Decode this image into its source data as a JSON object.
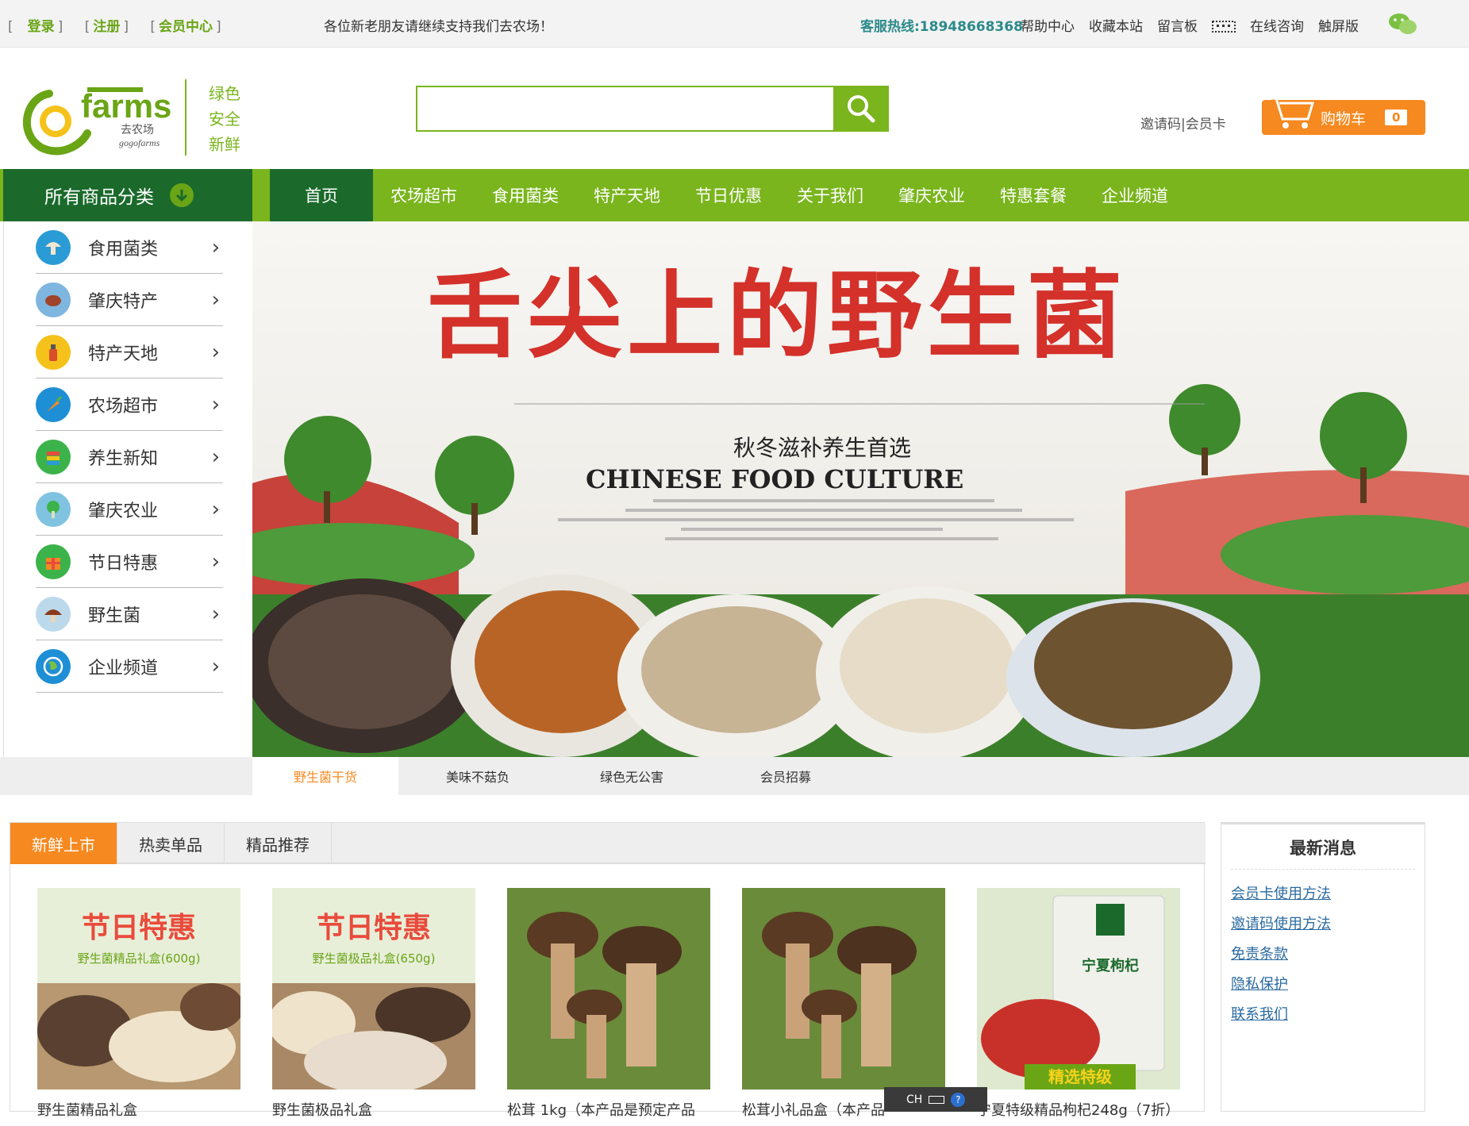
{
  "topbar": {
    "login": "登录",
    "register": "注册",
    "member_center": "会员中心",
    "bracket_l": "[",
    "bracket_r": "]",
    "notice": "各位新老朋友请继续支持我们去农场！",
    "hotline": "客服热线:18948668368",
    "links": [
      "帮助中心",
      "收藏本站",
      "留言板",
      "在线咨询",
      "触屏版"
    ]
  },
  "header": {
    "logo_text": "farms",
    "logo_cn": "去农场",
    "logo_en": "gogofarms",
    "slogan": [
      "绿色",
      "安全",
      "新鲜"
    ],
    "search_placeholder": "",
    "invite": "邀请码|会员卡",
    "cart_label": "购物车",
    "cart_count": "0"
  },
  "nav": {
    "all_categories": "所有商品分类",
    "items": [
      "首页",
      "农场超市",
      "食用菌类",
      "特产天地",
      "节日优惠",
      "关于我们",
      "肇庆农业",
      "特惠套餐",
      "企业频道"
    ]
  },
  "sidebar": {
    "items": [
      {
        "label": "食用菌类",
        "icon": "mushroom-icon"
      },
      {
        "label": "肇庆特产",
        "icon": "specialty-icon"
      },
      {
        "label": "特产天地",
        "icon": "bottle-icon"
      },
      {
        "label": "农场超市",
        "icon": "carrot-icon"
      },
      {
        "label": "养生新知",
        "icon": "books-icon"
      },
      {
        "label": "肇庆农业",
        "icon": "vegetable-icon"
      },
      {
        "label": "节日特惠",
        "icon": "gift-icon"
      },
      {
        "label": "野生菌",
        "icon": "wild-mushroom-icon"
      },
      {
        "label": "企业频道",
        "icon": "globe-icon"
      }
    ]
  },
  "banner": {
    "headline": "舌尖上的野生菌",
    "subtitle": "秋冬滋补养生首选",
    "title_en": "CHINESE FOOD CULTURE",
    "tabs": [
      "野生菌干货",
      "美味不菇负",
      "绿色无公害",
      "会员招募"
    ]
  },
  "products": {
    "tabs": [
      "新鲜上市",
      "热卖单品",
      "精品推荐"
    ],
    "items": [
      {
        "name": "野生菌精品礼盒",
        "tag": "节日特惠",
        "sub": "野生菌精品礼盒(600g)"
      },
      {
        "name": "野生菌极品礼盒",
        "tag": "节日特惠",
        "sub": "野生菌极品礼盒(650g)"
      },
      {
        "name": "松茸 1kg（本产品是预定产品",
        "tag": "",
        "sub": ""
      },
      {
        "name": "松茸小礼品盒（本产品",
        "tag": "",
        "sub": ""
      },
      {
        "name": "宁夏特级精品枸杞248g（7折）",
        "tag": "宁夏枸杞",
        "sub": "精选特级"
      }
    ]
  },
  "news": {
    "title": "最新消息",
    "items": [
      "会员卡使用方法",
      "邀请码使用方法",
      "免责条款",
      "隐私保护",
      "联系我们"
    ]
  },
  "ime": {
    "label": "CH"
  },
  "colors": {
    "green": "#7ab51d",
    "dark_green": "#1b6a2c",
    "orange": "#f6891f"
  }
}
